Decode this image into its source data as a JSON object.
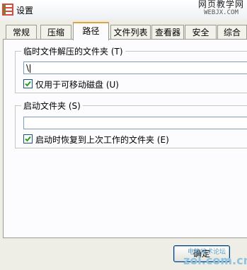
{
  "window": {
    "title": "设置",
    "watermark_line1": "网页教学网",
    "watermark_line2": "WEBJX.COM"
  },
  "tabs": [
    {
      "label": "常规",
      "active": false
    },
    {
      "label": "压缩",
      "active": false
    },
    {
      "label": "路径",
      "active": true
    },
    {
      "label": "文件列表",
      "active": false
    },
    {
      "label": "查看器",
      "active": false
    },
    {
      "label": "安全",
      "active": false
    },
    {
      "label": "综合",
      "active": false
    }
  ],
  "temp_group": {
    "legend": "临时文件解压的文件夹 (T)",
    "path_value": "\\",
    "checkbox_label": "仅用于可移动磁盘 (U)",
    "checkbox_checked": true
  },
  "startup_group": {
    "legend": "启动文件夹 (S)",
    "path_value": "",
    "checkbox_label": "启动时恢复到上次工作的文件夹 (E)",
    "checkbox_checked": true
  },
  "footer": {
    "ok_label": "确定",
    "logo_line1": "电脑技术论坛",
    "logo_line2": "zol.com.cn"
  },
  "colors": {
    "accent_tab": "#e6a23a",
    "panel_bg": "#fcfcfe",
    "window_bg": "#eeeee6",
    "input_border": "#7f9db9"
  }
}
